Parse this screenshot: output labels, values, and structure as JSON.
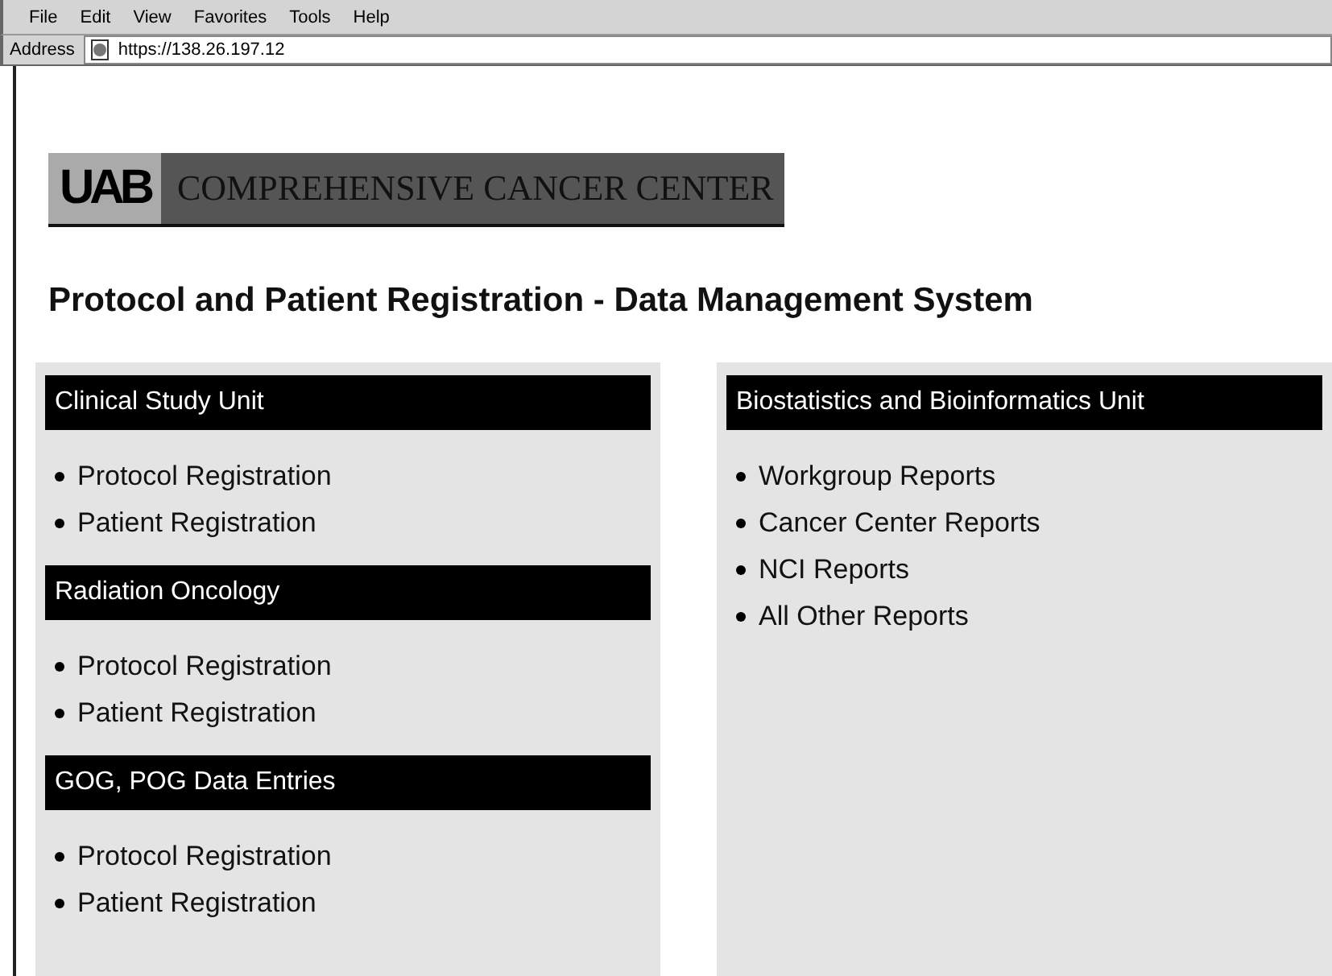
{
  "menu": [
    "File",
    "Edit",
    "View",
    "Favorites",
    "Tools",
    "Help"
  ],
  "address_bar": {
    "label": "Address",
    "value": "https://138.26.197.12"
  },
  "banner": {
    "logo_text": "UAB",
    "title": "COMPREHENSIVE CANCER CENTER"
  },
  "page_title": "Protocol and Patient Registration - Data Management System",
  "panels": [
    {
      "sections": [
        {
          "heading": "Clinical Study Unit",
          "links": [
            "Protocol Registration",
            "Patient Registration"
          ]
        },
        {
          "heading": "Radiation Oncology",
          "links": [
            "Protocol Registration",
            "Patient Registration"
          ]
        },
        {
          "heading": "GOG, POG Data Entries",
          "links": [
            "Protocol Registration",
            "Patient Registration"
          ]
        }
      ]
    },
    {
      "sections": [
        {
          "heading": "Biostatistics and Bioinformatics Unit",
          "links": [
            "Workgroup Reports",
            "Cancer Center Reports",
            "NCI Reports",
            "All Other Reports"
          ]
        }
      ]
    }
  ]
}
